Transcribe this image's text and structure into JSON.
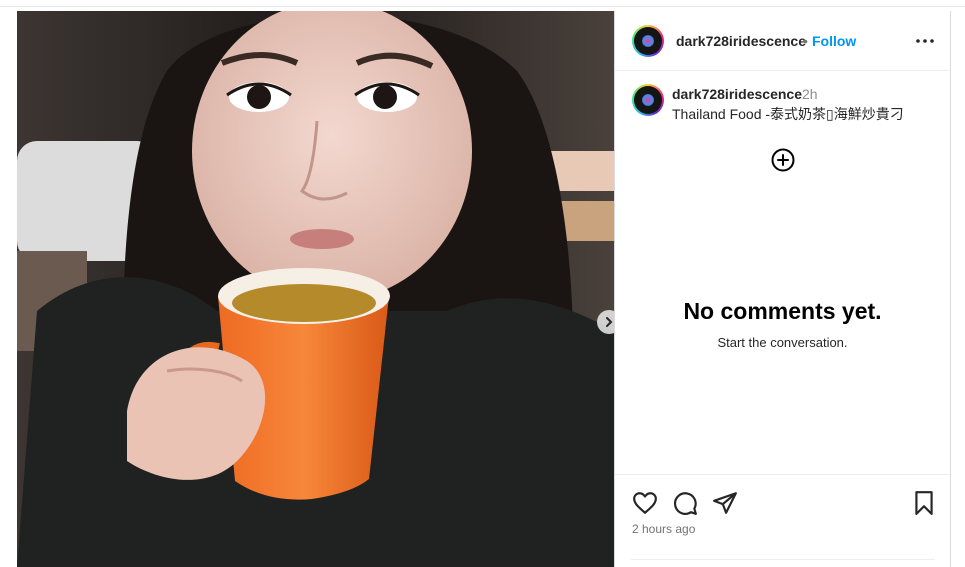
{
  "post": {
    "username": "dark728iridescence",
    "separator": "•",
    "follow_label": "Follow",
    "time_short": "2h",
    "caption": "Thailand Food -泰式奶茶▯海鮮炒貴刁",
    "time_long": "2 hours ago"
  },
  "comments": {
    "empty_title": "No comments yet.",
    "empty_subtitle": "Start the conversation."
  },
  "icons": {
    "more": "more-horizontal-icon",
    "add": "add-circle-icon",
    "like": "heart-icon",
    "comment": "comment-bubble-icon",
    "share": "paper-plane-icon",
    "save": "bookmark-icon",
    "next": "chevron-right-icon"
  },
  "colors": {
    "accent": "#0095f6",
    "text_secondary": "#737373",
    "border": "#dbdbdb"
  }
}
